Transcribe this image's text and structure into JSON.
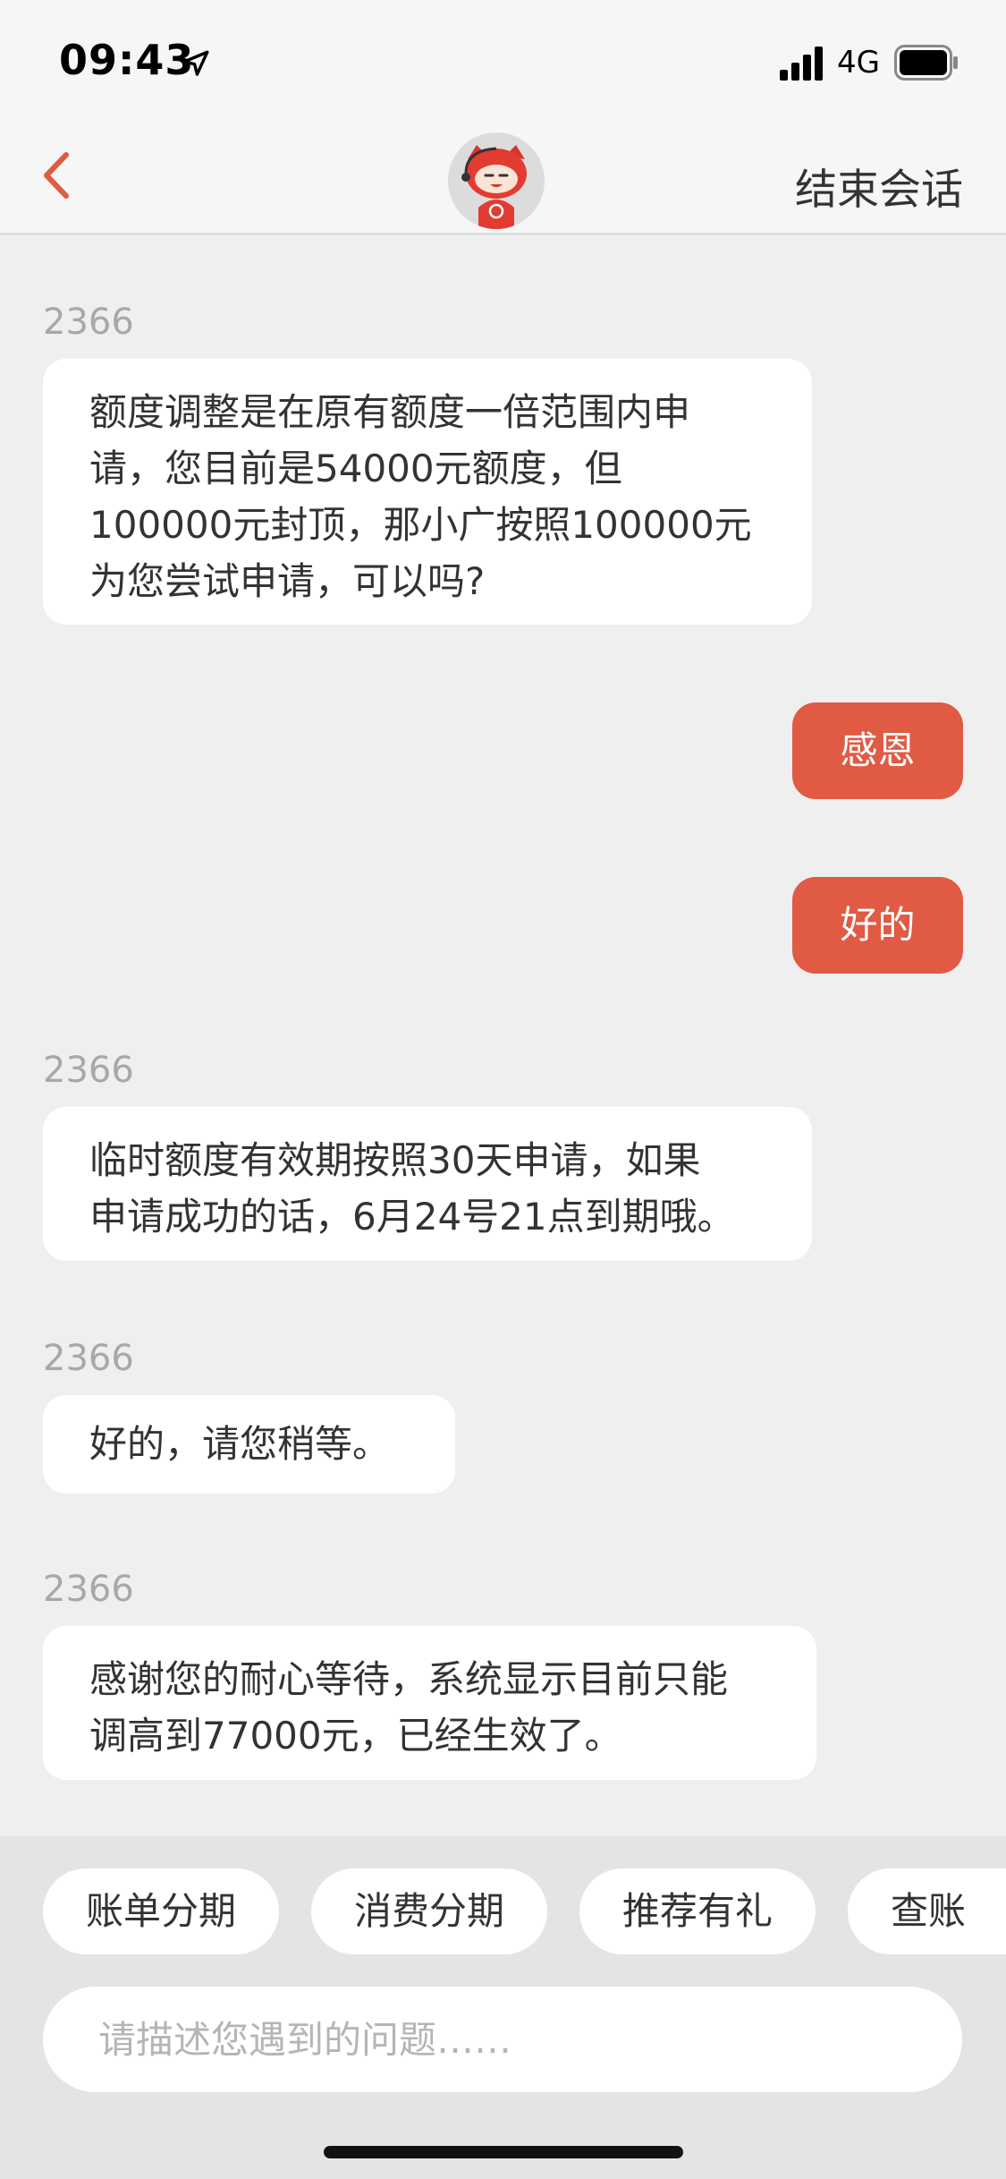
{
  "status_bar": {
    "time": "09:43",
    "network": "4G"
  },
  "nav": {
    "end_label": "结束会话"
  },
  "messages": [
    {
      "sender": "2366",
      "lines": [
        "额度调整是在原有额度一倍范围内申",
        "请，您目前是54000元额度，但",
        "100000元封顶，那小广按照100000元",
        "为您尝试申请，可以吗?"
      ]
    },
    {
      "text": "感恩"
    },
    {
      "text": "好的"
    },
    {
      "sender": "2366",
      "lines": [
        "临时额度有效期按照30天申请，如果",
        "申请成功的话，6月24号21点到期哦。"
      ]
    },
    {
      "sender": "2366",
      "lines": [
        "好的，请您稍等。"
      ]
    },
    {
      "sender": "2366",
      "lines": [
        "感谢您的耐心等待，系统显示目前只能",
        "调高到77000元，已经生效了。"
      ]
    }
  ],
  "quick_replies": [
    "账单分期",
    "消费分期",
    "推荐有礼",
    "查账"
  ],
  "input": {
    "placeholder": "请描述您遇到的问题……"
  },
  "colors": {
    "accent": "#e05a44",
    "background": "#efefef",
    "bubble": "#ffffff"
  }
}
